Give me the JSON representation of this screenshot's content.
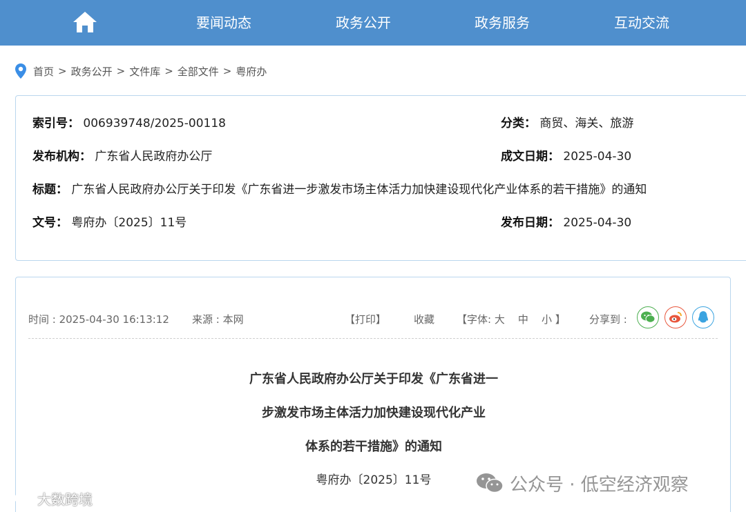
{
  "nav": {
    "home_icon": "home-icon",
    "items": [
      "要闻动态",
      "政务公开",
      "政务服务",
      "互动交流"
    ]
  },
  "breadcrumb": {
    "icon": "map-pin-icon",
    "items": [
      "首页",
      "政务公开",
      "文件库",
      "全部文件",
      "粤府办"
    ],
    "separator": ">"
  },
  "info": {
    "index_label": "索引号：",
    "index_value": "006939748/2025-00118",
    "category_label": "分类：",
    "category_value": "商贸、海关、旅游",
    "publisher_label": "发布机构：",
    "publisher_value": "广东省人民政府办公厅",
    "written_date_label": "成文日期：",
    "written_date_value": "2025-04-30",
    "title_label": "标题：",
    "title_value": "广东省人民政府办公厅关于印发《广东省进一步激发市场主体活力加快建设现代化产业体系的若干措施》的通知",
    "doc_no_label": "文号：",
    "doc_no_value": "粤府办〔2025〕11号",
    "publish_date_label": "发布日期：",
    "publish_date_value": "2025-04-30"
  },
  "article": {
    "time": "时间 : 2025-04-30 16:13:12",
    "source": "来源 : 本网",
    "print": "【打印】",
    "favorite": "收藏",
    "font_prefix": "【字体: ",
    "font_large": "大",
    "font_medium": "中",
    "font_small": "小",
    "font_suffix": "】",
    "share_label": "分享到 :",
    "share_buttons": [
      {
        "icon": "wechat-icon",
        "color": "#4caf50"
      },
      {
        "icon": "weibo-icon",
        "color": "#e8563c"
      },
      {
        "icon": "qq-icon",
        "color": "#3aa3e0"
      }
    ],
    "title_lines": [
      "广东省人民政府办公厅关于印发《广东省进一",
      "步激发市场主体活力加快建设现代化产业",
      "体系的若干措施》的通知"
    ],
    "doc_number": "粤府办〔2025〕11号"
  },
  "watermarks": {
    "right_text": "公众号 · 低空经济观察",
    "left_text": "大数跨境"
  },
  "colors": {
    "nav_bg": "#4f8fcd",
    "border": "#b9d6ee",
    "pin": "#3a8ee6"
  }
}
